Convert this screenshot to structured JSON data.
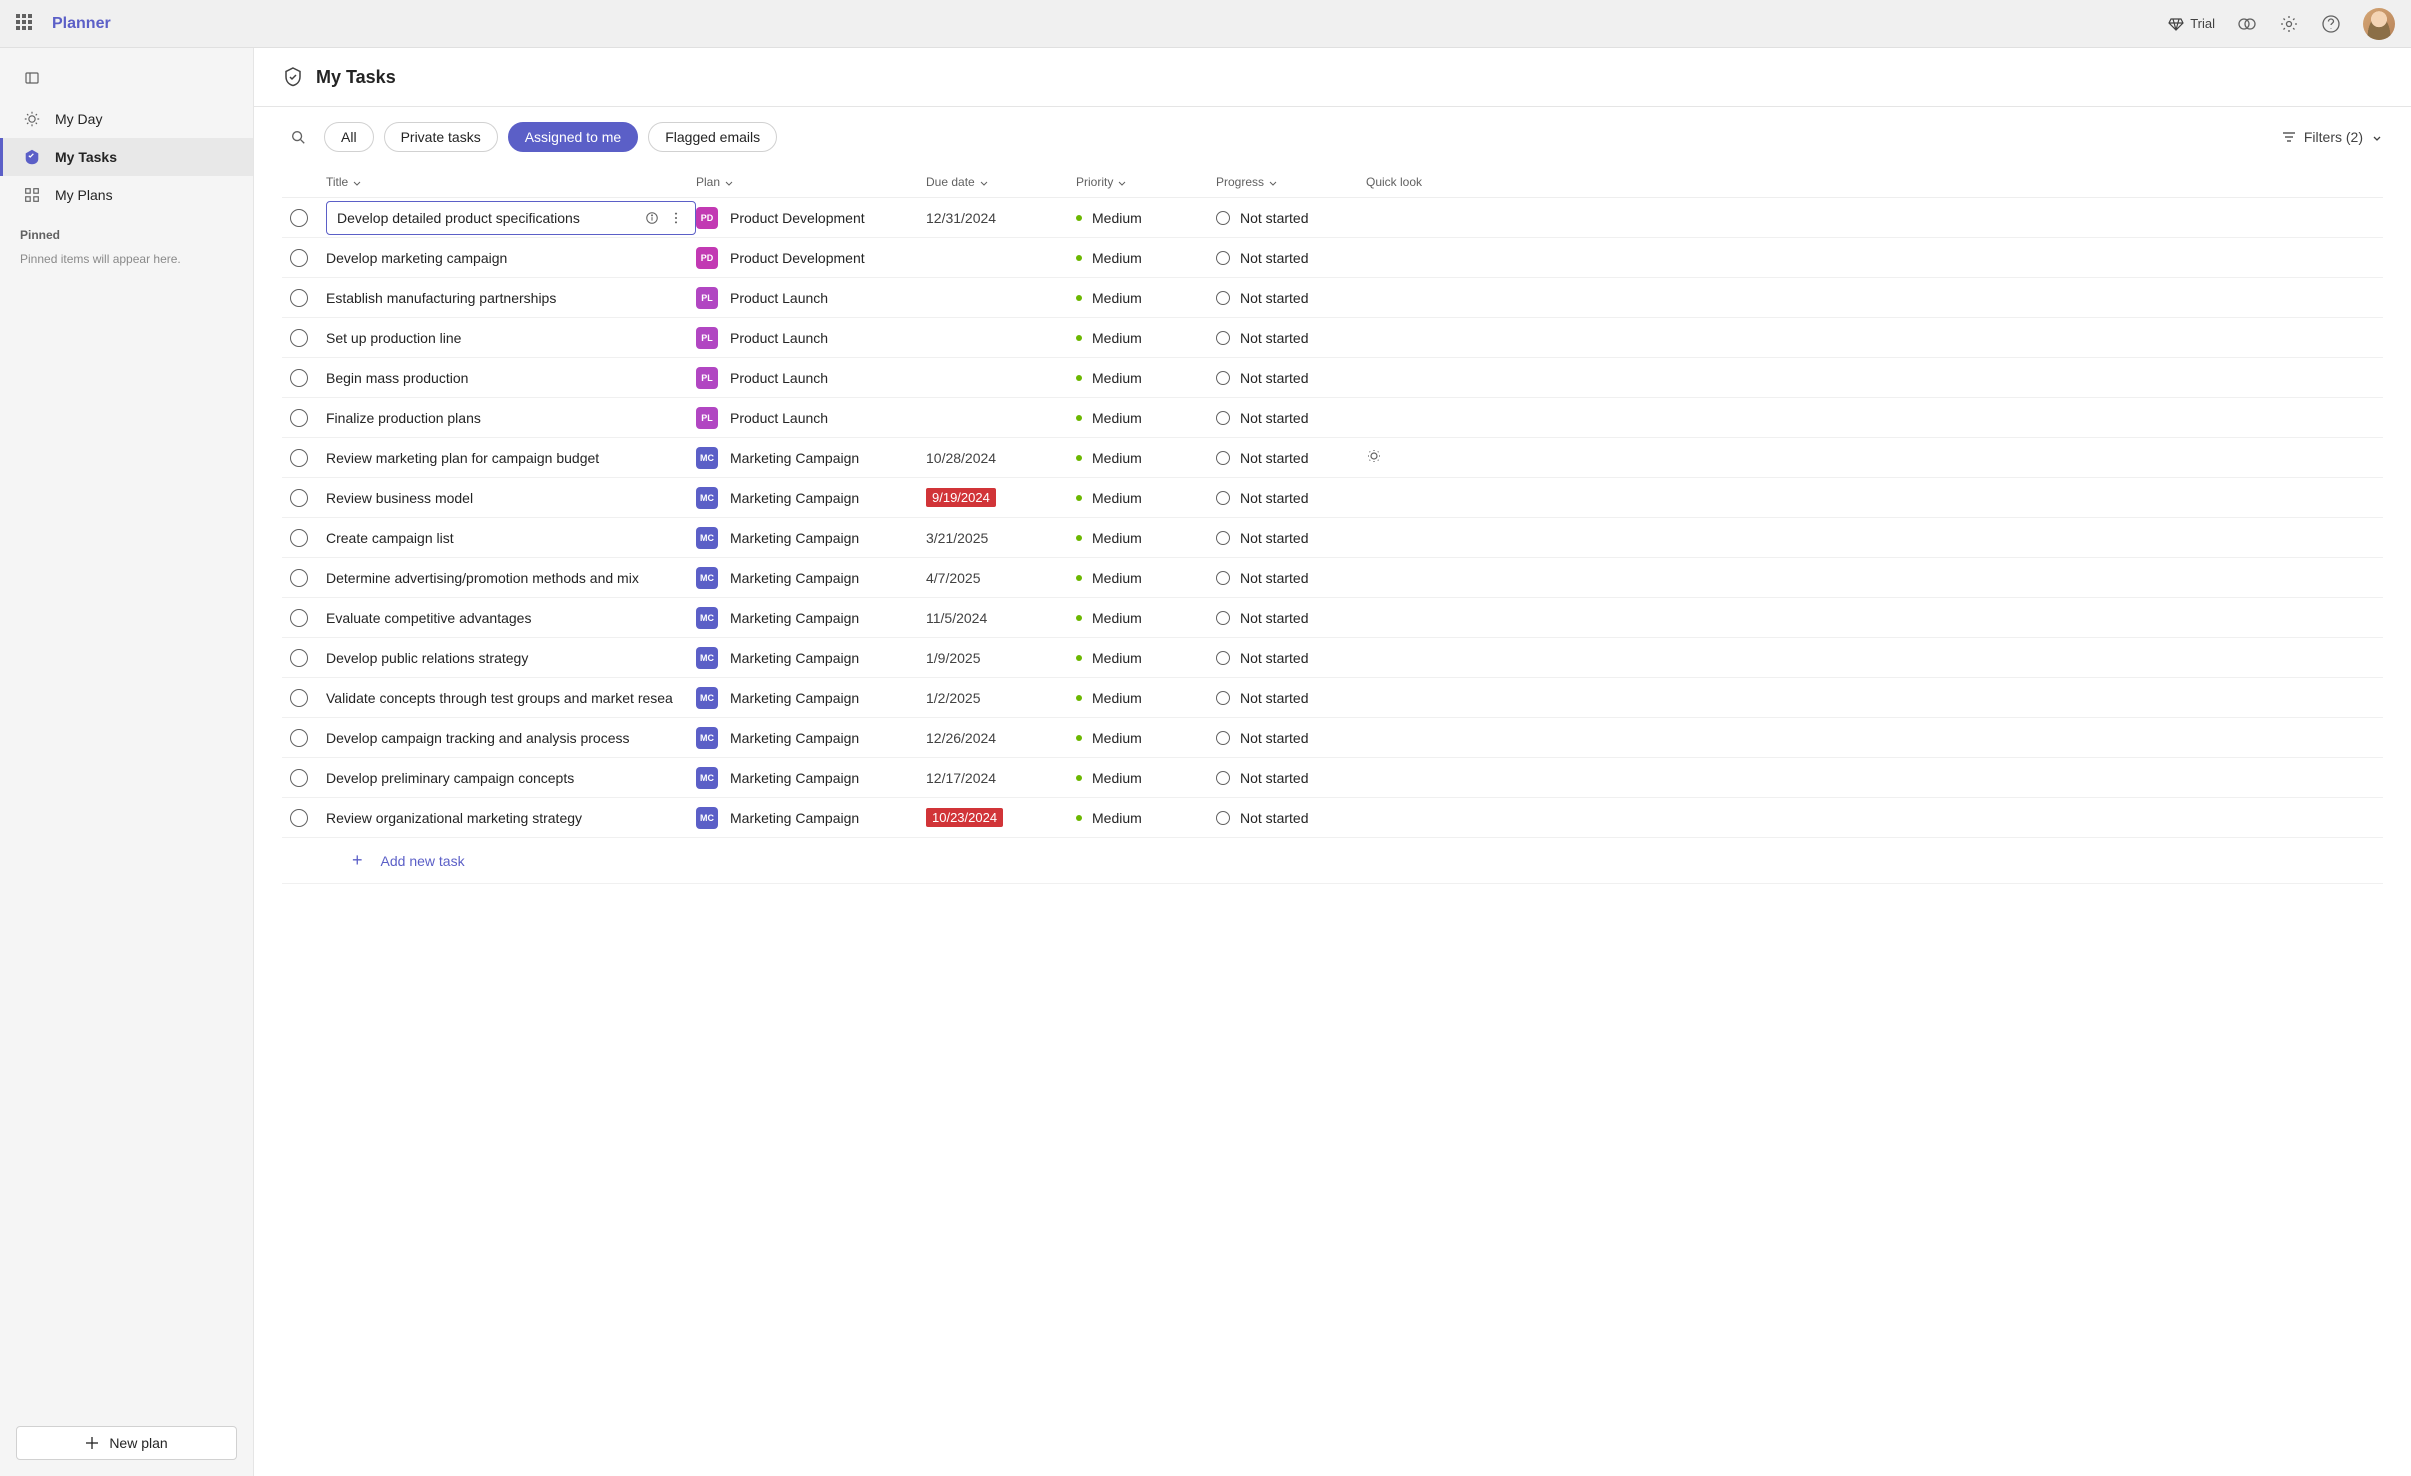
{
  "brand": "Planner",
  "topbar": {
    "trial": "Trial"
  },
  "sidebar": {
    "myDay": "My Day",
    "myTasks": "My Tasks",
    "myPlans": "My Plans",
    "pinnedLabel": "Pinned",
    "pinnedEmpty": "Pinned items will appear here.",
    "newPlan": "New plan"
  },
  "page": {
    "title": "My Tasks"
  },
  "toolbar": {
    "all": "All",
    "private": "Private tasks",
    "assigned": "Assigned to me",
    "flagged": "Flagged emails",
    "filters": "Filters (2)"
  },
  "columns": {
    "title": "Title",
    "plan": "Plan",
    "due": "Due date",
    "priority": "Priority",
    "progress": "Progress",
    "quicklook": "Quick look"
  },
  "addTask": "Add new task",
  "tasks": [
    {
      "title": "Develop detailed product specifications",
      "plan": "Product Development",
      "planCode": "PD",
      "planClass": "plan-pd",
      "due": "12/31/2024",
      "overdue": false,
      "priority": "Medium",
      "progress": "Not started",
      "editing": true,
      "quick": false
    },
    {
      "title": "Develop marketing campaign",
      "plan": "Product Development",
      "planCode": "PD",
      "planClass": "plan-pd",
      "due": "",
      "overdue": false,
      "priority": "Medium",
      "progress": "Not started",
      "editing": false,
      "quick": false
    },
    {
      "title": "Establish manufacturing partnerships",
      "plan": "Product Launch",
      "planCode": "PL",
      "planClass": "plan-pl",
      "due": "",
      "overdue": false,
      "priority": "Medium",
      "progress": "Not started",
      "editing": false,
      "quick": false
    },
    {
      "title": "Set up production line",
      "plan": "Product Launch",
      "planCode": "PL",
      "planClass": "plan-pl",
      "due": "",
      "overdue": false,
      "priority": "Medium",
      "progress": "Not started",
      "editing": false,
      "quick": false
    },
    {
      "title": "Begin mass production",
      "plan": "Product Launch",
      "planCode": "PL",
      "planClass": "plan-pl",
      "due": "",
      "overdue": false,
      "priority": "Medium",
      "progress": "Not started",
      "editing": false,
      "quick": false
    },
    {
      "title": "Finalize production plans",
      "plan": "Product Launch",
      "planCode": "PL",
      "planClass": "plan-pl",
      "due": "",
      "overdue": false,
      "priority": "Medium",
      "progress": "Not started",
      "editing": false,
      "quick": false
    },
    {
      "title": "Review marketing plan for campaign budget",
      "plan": "Marketing Campaign",
      "planCode": "MC",
      "planClass": "plan-mc",
      "due": "10/28/2024",
      "overdue": false,
      "priority": "Medium",
      "progress": "Not started",
      "editing": false,
      "quick": true
    },
    {
      "title": "Review business model",
      "plan": "Marketing Campaign",
      "planCode": "MC",
      "planClass": "plan-mc",
      "due": "9/19/2024",
      "overdue": true,
      "priority": "Medium",
      "progress": "Not started",
      "editing": false,
      "quick": false
    },
    {
      "title": "Create campaign list",
      "plan": "Marketing Campaign",
      "planCode": "MC",
      "planClass": "plan-mc",
      "due": "3/21/2025",
      "overdue": false,
      "priority": "Medium",
      "progress": "Not started",
      "editing": false,
      "quick": false
    },
    {
      "title": "Determine advertising/promotion methods and mix",
      "plan": "Marketing Campaign",
      "planCode": "MC",
      "planClass": "plan-mc",
      "due": "4/7/2025",
      "overdue": false,
      "priority": "Medium",
      "progress": "Not started",
      "editing": false,
      "quick": false
    },
    {
      "title": "Evaluate competitive advantages",
      "plan": "Marketing Campaign",
      "planCode": "MC",
      "planClass": "plan-mc",
      "due": "11/5/2024",
      "overdue": false,
      "priority": "Medium",
      "progress": "Not started",
      "editing": false,
      "quick": false
    },
    {
      "title": "Develop public relations strategy",
      "plan": "Marketing Campaign",
      "planCode": "MC",
      "planClass": "plan-mc",
      "due": "1/9/2025",
      "overdue": false,
      "priority": "Medium",
      "progress": "Not started",
      "editing": false,
      "quick": false
    },
    {
      "title": "Validate concepts through test groups and market resea",
      "plan": "Marketing Campaign",
      "planCode": "MC",
      "planClass": "plan-mc",
      "due": "1/2/2025",
      "overdue": false,
      "priority": "Medium",
      "progress": "Not started",
      "editing": false,
      "quick": false
    },
    {
      "title": "Develop campaign tracking and analysis process",
      "plan": "Marketing Campaign",
      "planCode": "MC",
      "planClass": "plan-mc",
      "due": "12/26/2024",
      "overdue": false,
      "priority": "Medium",
      "progress": "Not started",
      "editing": false,
      "quick": false
    },
    {
      "title": "Develop preliminary campaign concepts",
      "plan": "Marketing Campaign",
      "planCode": "MC",
      "planClass": "plan-mc",
      "due": "12/17/2024",
      "overdue": false,
      "priority": "Medium",
      "progress": "Not started",
      "editing": false,
      "quick": false
    },
    {
      "title": "Review organizational marketing strategy",
      "plan": "Marketing Campaign",
      "planCode": "MC",
      "planClass": "plan-mc",
      "due": "10/23/2024",
      "overdue": true,
      "priority": "Medium",
      "progress": "Not started",
      "editing": false,
      "quick": false
    }
  ]
}
